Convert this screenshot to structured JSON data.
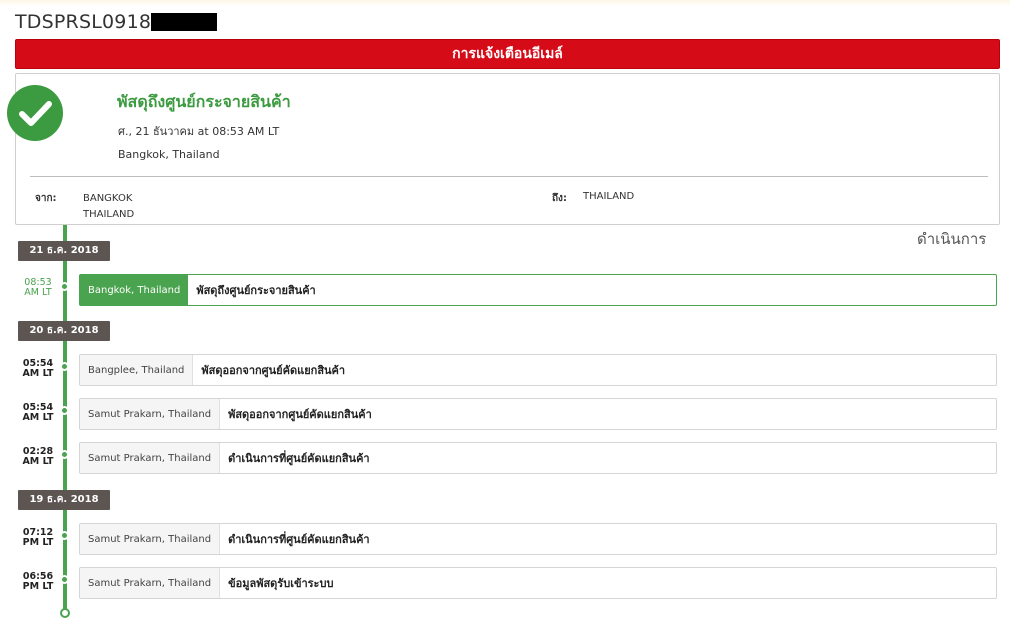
{
  "tracking": {
    "number": "TDSPRSL0918"
  },
  "email_button": {
    "label": "การแจ้งเตือนอีเมล์"
  },
  "status": {
    "title": "พัสดุถึงศูนย์กระจายสินค้า",
    "date": "ศ., 21 ธันวาคม at 08:53 AM LT",
    "location": "Bangkok, Thailand",
    "icon": "check-circle-icon"
  },
  "route": {
    "from_label": "จาก:",
    "from_city": "BANGKOK",
    "from_country": "THAILAND",
    "to_label": "ถึง:",
    "to_value": "THAILAND"
  },
  "progress_title": "ดำเนินการ",
  "colors": {
    "accent": "#3c9b41",
    "alert": "#d60b18",
    "badge": "#5d5552"
  },
  "days": [
    {
      "date": "21 ธ.ค. 2018",
      "events": [
        {
          "time": "08:53",
          "ampm": "AM LT",
          "location": "Bangkok, Thailand",
          "description": "พัสดุถึงศูนย์กระจายสินค้า"
        }
      ]
    },
    {
      "date": "20 ธ.ค. 2018",
      "events": [
        {
          "time": "05:54",
          "ampm": "AM LT",
          "location": "Bangplee, Thailand",
          "description": "พัสดุออกจากศูนย์คัดแยกสินค้า"
        },
        {
          "time": "05:54",
          "ampm": "AM LT",
          "location": "Samut Prakarn, Thailand",
          "description": "พัสดุออกจากศูนย์คัดแยกสินค้า"
        },
        {
          "time": "02:28",
          "ampm": "AM LT",
          "location": "Samut Prakarn, Thailand",
          "description": "ดำเนินการที่ศูนย์คัดแยกสินค้า"
        }
      ]
    },
    {
      "date": "19 ธ.ค. 2018",
      "events": [
        {
          "time": "07:12",
          "ampm": "PM LT",
          "location": "Samut Prakarn, Thailand",
          "description": "ดำเนินการที่ศูนย์คัดแยกสินค้า"
        },
        {
          "time": "06:56",
          "ampm": "PM LT",
          "location": "Samut Prakarn, Thailand",
          "description": "ข้อมูลพัสดุรับเข้าระบบ"
        }
      ]
    }
  ]
}
